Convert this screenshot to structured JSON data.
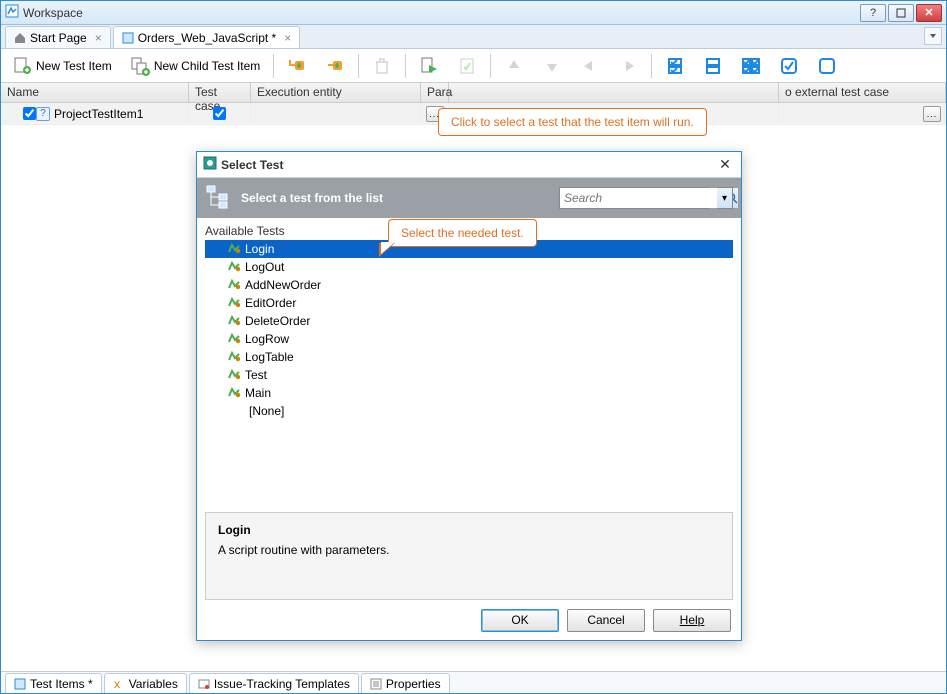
{
  "window": {
    "title": "Workspace"
  },
  "tabs": {
    "start": "Start Page",
    "doc": "Orders_Web_JavaScript *"
  },
  "toolbar": {
    "new_item": "New Test Item",
    "new_child_item": "New Child Test Item"
  },
  "grid": {
    "cols": {
      "name": "Name",
      "testcase": "Test case",
      "exec": "Execution entity",
      "params": "Para",
      "linkext": "o external test case"
    },
    "row1": {
      "name": "ProjectTestItem1",
      "dots": "..."
    }
  },
  "callouts": {
    "c1": "Click to select a test that the test item will run.",
    "c2": "Select the needed test."
  },
  "dialog": {
    "title": "Select Test",
    "head_text": "Select a test from the list",
    "search_placeholder": "Search",
    "available": "Available Tests",
    "tests": [
      "Login",
      "LogOut",
      "AddNewOrder",
      "EditOrder",
      "DeleteOrder",
      "LogRow",
      "LogTable",
      "Test",
      "Main",
      "[None]"
    ],
    "selected": "Login",
    "desc_title": "Login",
    "desc_body": "A script routine with parameters.",
    "buttons": {
      "ok": "OK",
      "cancel": "Cancel",
      "help": "Help"
    }
  },
  "bottom_tabs": {
    "items": "Test Items *",
    "vars": "Variables",
    "issue": "Issue-Tracking Templates",
    "props": "Properties"
  }
}
